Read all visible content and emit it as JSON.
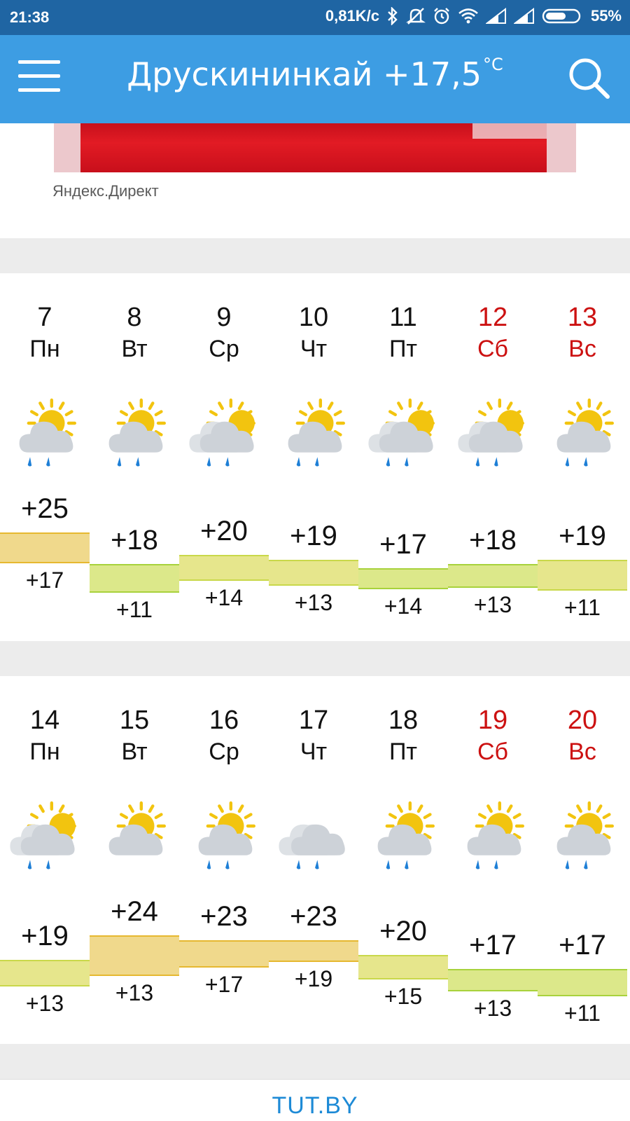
{
  "status_bar": {
    "time": "21:38",
    "speed": "0,81K/c",
    "battery": "55%"
  },
  "app_bar": {
    "title": "Друскининкай +17,5",
    "unit": "°C"
  },
  "ad": {
    "caption": "Яндекс.Директ"
  },
  "colors": {
    "app_bar": "#3d9de3",
    "status_bar": "#1f65a3",
    "weekend": "#cc1111",
    "warm": "#f0d98c",
    "mild": "#e6e68c",
    "cool": "#dce88a"
  },
  "weeks": [
    {
      "days": [
        {
          "num": "7",
          "dow": "Пн",
          "weekend": false,
          "icon": "partly-cloudy-rain-icon",
          "max": "+25",
          "min": "+17"
        },
        {
          "num": "8",
          "dow": "Вт",
          "weekend": false,
          "icon": "partly-cloudy-rain-icon",
          "max": "+18",
          "min": "+11"
        },
        {
          "num": "9",
          "dow": "Ср",
          "weekend": false,
          "icon": "cloudy-sun-rain-icon",
          "max": "+20",
          "min": "+14"
        },
        {
          "num": "10",
          "dow": "Чт",
          "weekend": false,
          "icon": "partly-cloudy-rain-icon",
          "max": "+19",
          "min": "+13"
        },
        {
          "num": "11",
          "dow": "Пт",
          "weekend": false,
          "icon": "cloudy-sun-rain-icon",
          "max": "+17",
          "min": "+14"
        },
        {
          "num": "12",
          "dow": "Сб",
          "weekend": true,
          "icon": "cloudy-sun-rain-icon",
          "max": "+18",
          "min": "+13"
        },
        {
          "num": "13",
          "dow": "Вс",
          "weekend": true,
          "icon": "partly-cloudy-rain-icon",
          "max": "+19",
          "min": "+11"
        }
      ]
    },
    {
      "days": [
        {
          "num": "14",
          "dow": "Пн",
          "weekend": false,
          "icon": "cloudy-sun-rain-icon",
          "max": "+19",
          "min": "+13"
        },
        {
          "num": "15",
          "dow": "Вт",
          "weekend": false,
          "icon": "partly-cloudy-icon",
          "max": "+24",
          "min": "+13"
        },
        {
          "num": "16",
          "dow": "Ср",
          "weekend": false,
          "icon": "partly-cloudy-rain-icon",
          "max": "+23",
          "min": "+17"
        },
        {
          "num": "17",
          "dow": "Чт",
          "weekend": false,
          "icon": "overcast-rain-icon",
          "max": "+23",
          "min": "+19"
        },
        {
          "num": "18",
          "dow": "Пт",
          "weekend": false,
          "icon": "partly-cloudy-rain-icon",
          "max": "+20",
          "min": "+15"
        },
        {
          "num": "19",
          "dow": "Сб",
          "weekend": true,
          "icon": "partly-cloudy-rain-icon",
          "max": "+17",
          "min": "+13"
        },
        {
          "num": "20",
          "dow": "Вс",
          "weekend": true,
          "icon": "partly-cloudy-rain-icon",
          "max": "+17",
          "min": "+11"
        }
      ]
    }
  ],
  "footer": {
    "brand": "TUT.BY"
  }
}
